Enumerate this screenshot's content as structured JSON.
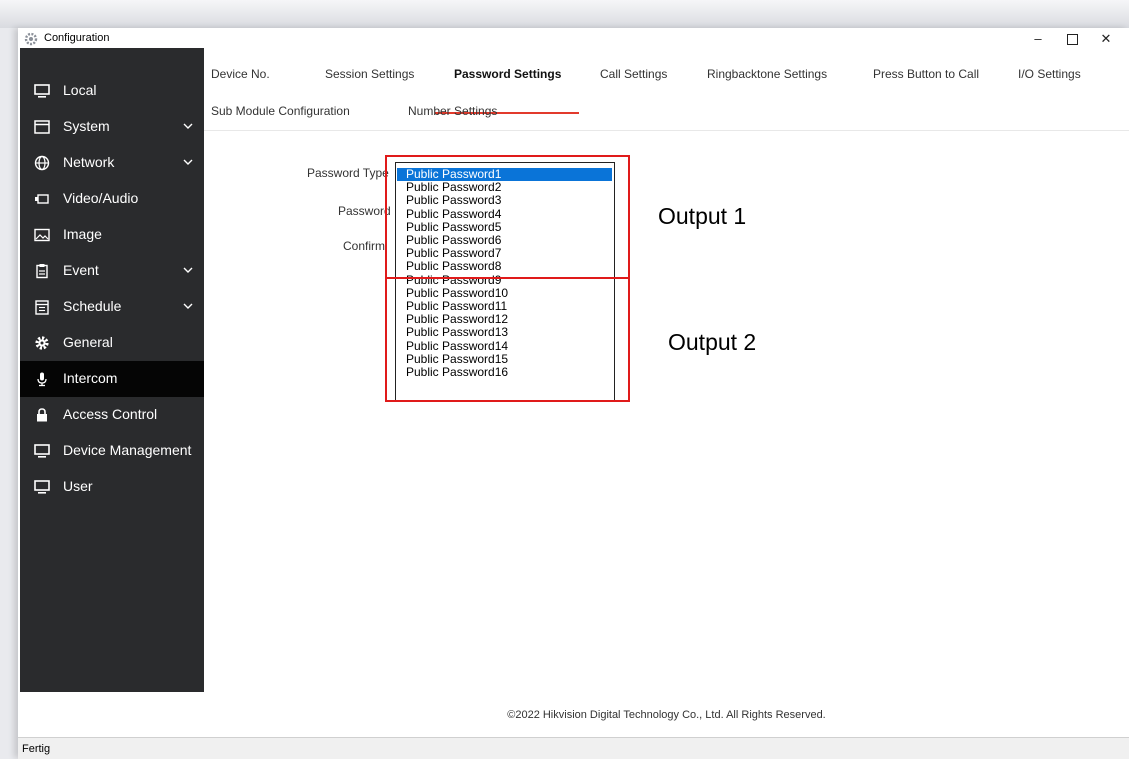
{
  "window": {
    "title": "Configuration",
    "minimize_icon": "minimize-icon",
    "maximize_icon": "maximize-icon",
    "close_icon": "close-icon"
  },
  "sidebar": {
    "items": [
      {
        "label": "Local",
        "icon": "monitor-icon",
        "chevron": false
      },
      {
        "label": "System",
        "icon": "window-icon",
        "chevron": true
      },
      {
        "label": "Network",
        "icon": "globe-icon",
        "chevron": true
      },
      {
        "label": "Video/Audio",
        "icon": "camera-icon",
        "chevron": false
      },
      {
        "label": "Image",
        "icon": "image-icon",
        "chevron": false
      },
      {
        "label": "Event",
        "icon": "clipboard-icon",
        "chevron": true
      },
      {
        "label": "Schedule",
        "icon": "calendar-icon",
        "chevron": true
      },
      {
        "label": "General",
        "icon": "gear-icon",
        "chevron": false
      },
      {
        "label": "Intercom",
        "icon": "microphone-icon",
        "chevron": false,
        "active": true
      },
      {
        "label": "Access Control",
        "icon": "lock-icon",
        "chevron": false
      },
      {
        "label": "Device Management",
        "icon": "monitor-icon",
        "chevron": false
      },
      {
        "label": "User",
        "icon": "monitor-icon",
        "chevron": false
      }
    ]
  },
  "tabs": {
    "row1": [
      "Device No.",
      "Session Settings",
      "Password Settings",
      "Call Settings",
      "Ringbacktone Settings",
      "Press Button to Call",
      "I/O Settings"
    ],
    "row2": [
      "Sub Module Configuration",
      "Number Settings"
    ],
    "active": "Password Settings"
  },
  "form": {
    "password_type_label": "Password Type",
    "password_label": "Password",
    "confirm_label": "Confirm",
    "password_type_options": [
      "Public Password1",
      "Public Password2",
      "Public Password3",
      "Public Password4",
      "Public Password5",
      "Public Password6",
      "Public Password7",
      "Public Password8",
      "Public Password9",
      "Public Password10",
      "Public Password11",
      "Public Password12",
      "Public Password13",
      "Public Password14",
      "Public Password15",
      "Public Password16"
    ],
    "selected_option": "Public Password1"
  },
  "annotations": {
    "output1": "Output 1",
    "output2": "Output 2",
    "box_color": "#e01a1a"
  },
  "footer": {
    "copyright": "©2022 Hikvision Digital Technology Co., Ltd. All Rights Reserved."
  },
  "status": {
    "text": "Fertig"
  },
  "colors": {
    "sidebar_bg": "#2a2b2d",
    "sidebar_active": "#050505",
    "tab_underline": "#e23a2c",
    "selection": "#0a74d8"
  }
}
